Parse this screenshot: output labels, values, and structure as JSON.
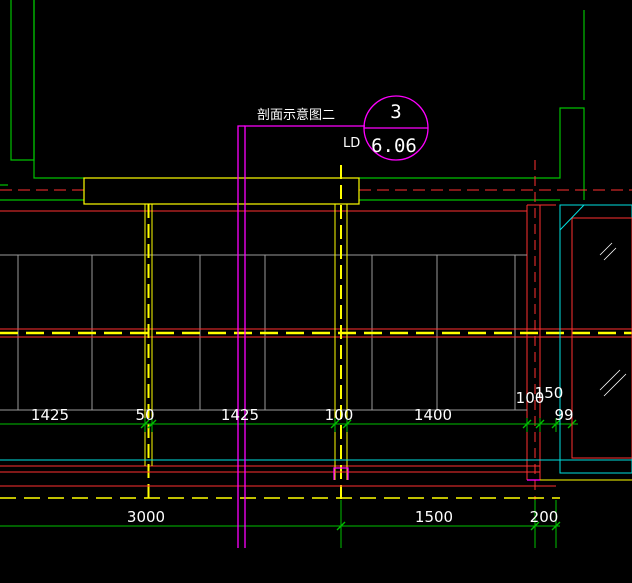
{
  "drawing": {
    "section_label": "剖面示意图二",
    "ld_label": "LD",
    "detail_bubble": {
      "number": "3",
      "sheet": "6.06"
    },
    "dims_upper": [
      "1425",
      "50",
      "1425",
      "100",
      "1400",
      "100",
      "150",
      "99"
    ],
    "dims_lower": [
      "3000",
      "1500",
      "200"
    ],
    "colors": {
      "background": "#000000",
      "green": "#00c000",
      "red": "#ff3030",
      "yellow": "#ffff00",
      "magenta": "#ff00ff",
      "cyan": "#00e0e0",
      "grey": "#9a9a9a",
      "white": "#ffffff"
    }
  }
}
